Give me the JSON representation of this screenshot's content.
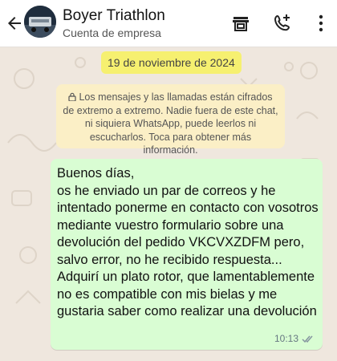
{
  "header": {
    "title": "Boyer Triathlon",
    "subtitle": "Cuenta de empresa",
    "icons": [
      "back-arrow-icon",
      "storefront-icon",
      "add-call-icon",
      "more-vert-icon"
    ]
  },
  "chat": {
    "date": "19 de noviembre de 2024",
    "encryption_notice": "Los mensajes y las llamadas están cifrados de extremo a extremo. Nadie fuera de este chat, ni siquiera WhatsApp, puede leerlos ni escucharlos. Toca para obtener más información.",
    "message": {
      "text": "Buenos días,\nos he enviado un par de correos y he intentado ponerme en contacto con vosotros mediante vuestro formulario sobre una devolución del pedido VKCVXZDFM pero, salvo error, no he recibido respuesta...\nAdquirí un plato rotor, que lamentablemente no es compatible con mis bielas y me gustaria saber como realizar una devolución",
      "time": "10:13",
      "status": "read-ticks-icon"
    }
  },
  "colors": {
    "outgoing_bubble": "#d9fdd3",
    "chat_background": "#efe7de",
    "date_highlight": "#f6f070",
    "notice_background": "#fbefc6"
  }
}
